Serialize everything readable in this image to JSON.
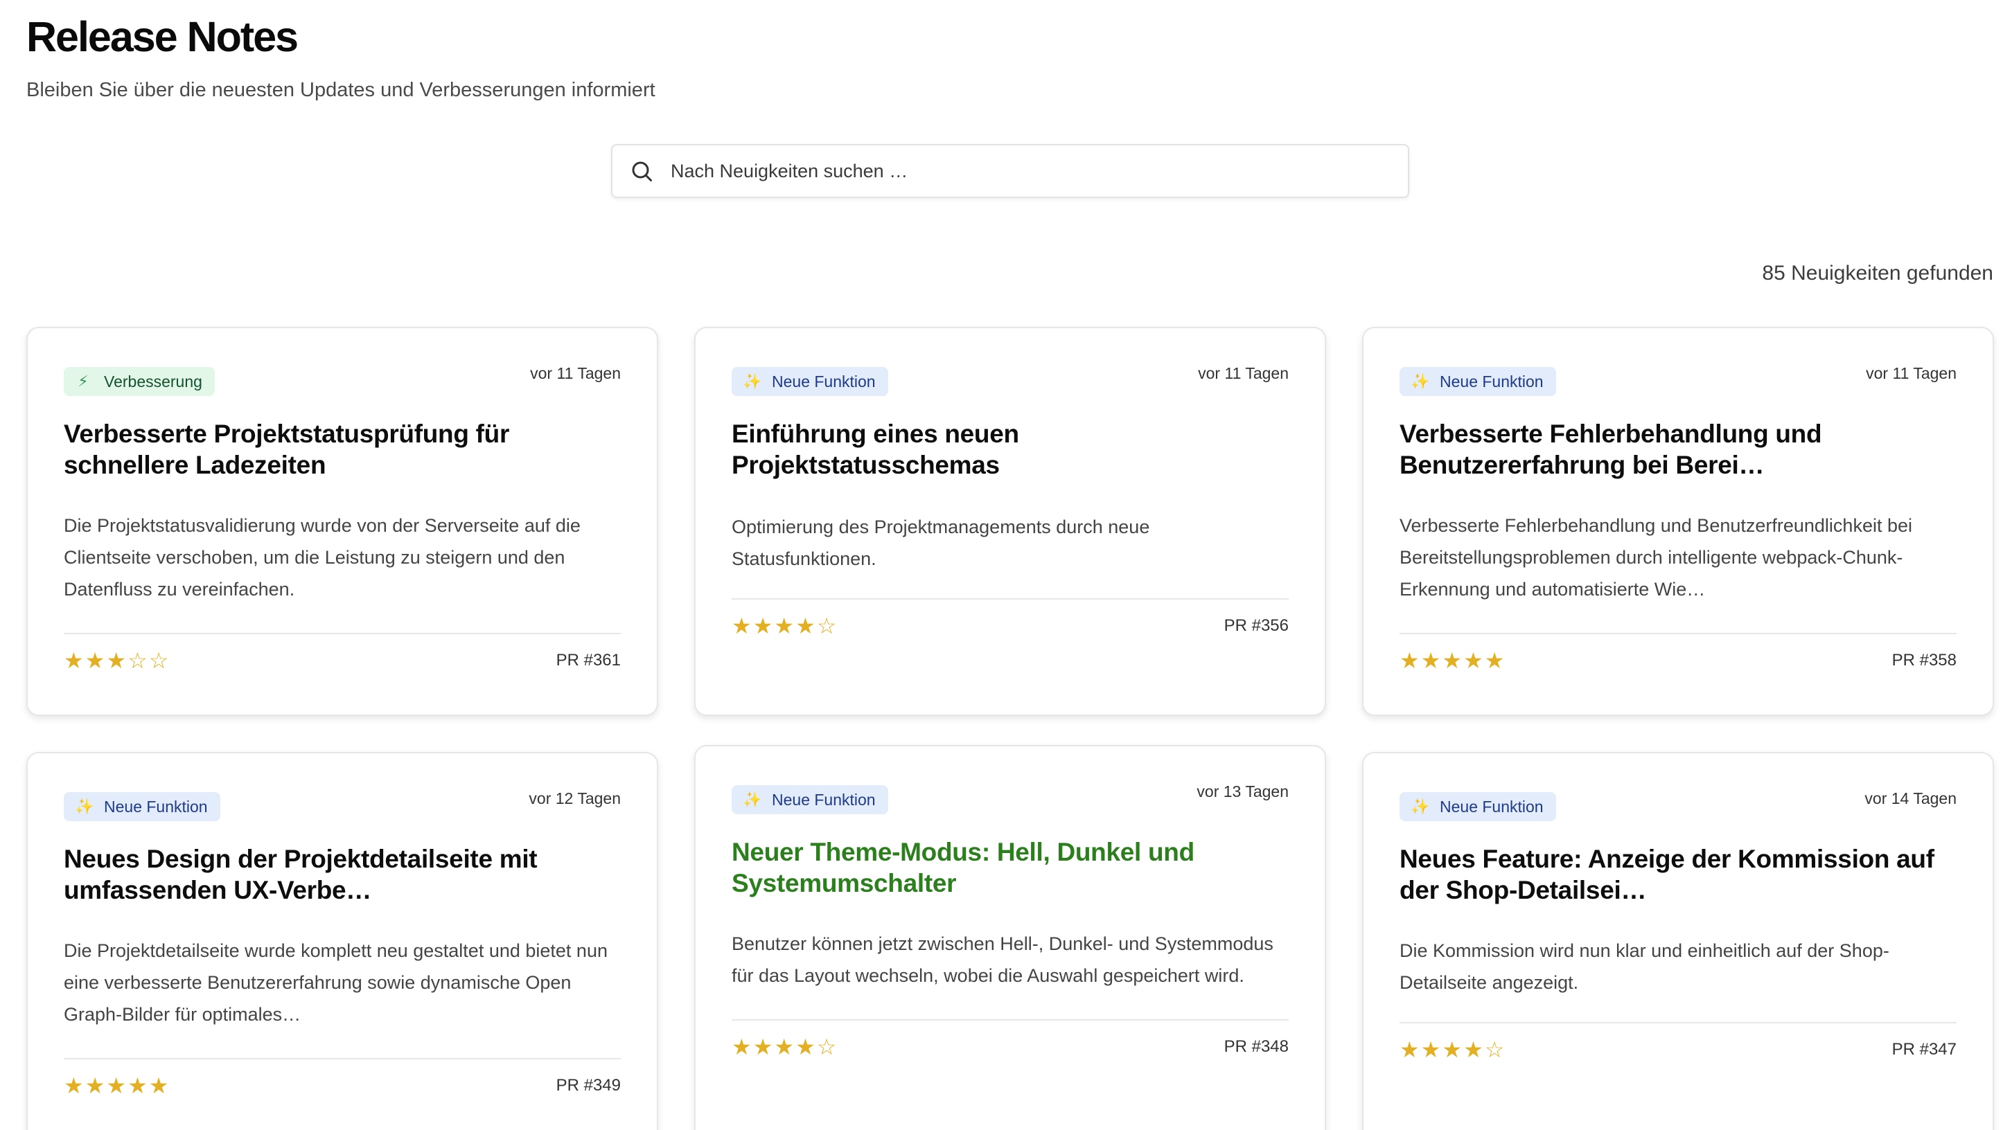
{
  "header": {
    "title": "Release Notes",
    "subtitle": "Bleiben Sie über die neuesten Updates und Verbesserungen informiert"
  },
  "search": {
    "placeholder": "Nach Neuigkeiten suchen …",
    "value": ""
  },
  "results": {
    "count_label": "85 Neuigkeiten gefunden"
  },
  "cards": [
    {
      "badge": "Verbesserung",
      "badge_icon": "lightning-icon",
      "date": "vor 11 Tagen",
      "title": "Verbesserte Projektstatusprüfung für schnellere Ladezeiten",
      "description": "Die Projektstatusvalidierung wurde von der Serverseite auf die Clientseite verschoben, um die Leistung zu steigern und den Datenfluss zu vereinfachen.",
      "rating": 3,
      "pr": "PR #361"
    },
    {
      "badge": "Neue Funktion",
      "badge_icon": "sparkles-icon",
      "date": "vor 11 Tagen",
      "title": "Einführung eines neuen Projektstatusschemas",
      "description": "Optimierung des Projektmanagements durch neue Statusfunktionen.",
      "rating": 4,
      "pr": "PR #356"
    },
    {
      "badge": "Neue Funktion",
      "badge_icon": "sparkles-icon",
      "date": "vor 11 Tagen",
      "title": "Verbesserte Fehlerbehandlung und Benutzererfahrung bei Berei…",
      "description": "Verbesserte Fehlerbehandlung und Benutzerfreundlichkeit bei Bereitstellungsproblemen durch intelligente webpack-Chunk-Erkennung und automatisierte Wie…",
      "rating": 5,
      "pr": "PR #358"
    },
    {
      "badge": "Neue Funktion",
      "badge_icon": "sparkles-icon",
      "date": "vor 12 Tagen",
      "title": "Neues Design der Projektdetailseite mit umfassenden UX-Verbe…",
      "description": "Die Projektdetailseite wurde komplett neu gestaltet und bietet nun eine verbesserte Benutzererfahrung sowie dynamische Open Graph-Bilder für optimales…",
      "rating": 5,
      "pr": "PR #349"
    },
    {
      "badge": "Neue Funktion",
      "badge_icon": "sparkles-icon",
      "date": "vor 13 Tagen",
      "title": "Neuer Theme-Modus: Hell, Dunkel und Systemumschalter",
      "description": "Benutzer können jetzt zwischen Hell-, Dunkel- und Systemmodus für das Layout wechseln, wobei die Auswahl gespeichert wird.",
      "rating": 4,
      "pr": "PR #348",
      "title_color": "#2b7f1c"
    },
    {
      "badge": "Neue Funktion",
      "badge_icon": "sparkles-icon",
      "date": "vor 14 Tagen",
      "title": "Neues Feature: Anzeige der Kommission auf der Shop-Detailsei…",
      "description": "Die Kommission wird nun klar und einheitlich auf der Shop-Detailseite angezeigt.",
      "rating": 4,
      "pr": "PR #347"
    }
  ],
  "colors": {
    "star": "#e2b022",
    "hover_title": "#2b7f1c",
    "badge_improve_bg": "#e3f7e8",
    "badge_feature_bg": "#e3ecfa"
  }
}
